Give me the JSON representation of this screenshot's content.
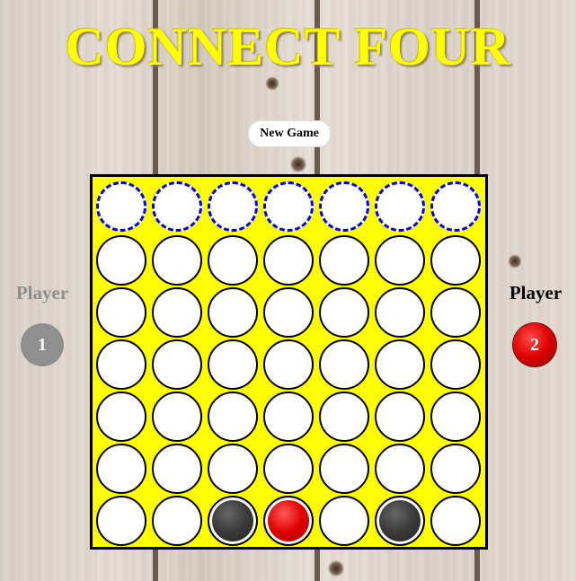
{
  "title": "CONNECT FOUR",
  "new_game_label": "New Game",
  "players": [
    {
      "label": "Player",
      "number": "1",
      "active": false,
      "color": "#8f8f8f"
    },
    {
      "label": "Player",
      "number": "2",
      "active": true,
      "color": "#dd0000"
    }
  ],
  "board": {
    "columns": 7,
    "rows": 6,
    "cells": [
      [
        "empty",
        "empty",
        "empty",
        "empty",
        "empty",
        "empty",
        "empty"
      ],
      [
        "empty",
        "empty",
        "empty",
        "empty",
        "empty",
        "empty",
        "empty"
      ],
      [
        "empty",
        "empty",
        "empty",
        "empty",
        "empty",
        "empty",
        "empty"
      ],
      [
        "empty",
        "empty",
        "empty",
        "empty",
        "empty",
        "empty",
        "empty"
      ],
      [
        "empty",
        "empty",
        "empty",
        "empty",
        "empty",
        "empty",
        "empty"
      ],
      [
        "empty",
        "empty",
        "black",
        "red",
        "empty",
        "black",
        "empty"
      ]
    ]
  },
  "colors": {
    "board": "#ffff00",
    "drop_ring": "#0000dd",
    "player1_disc": "#3a3a3a",
    "player2_disc": "#e00000"
  }
}
